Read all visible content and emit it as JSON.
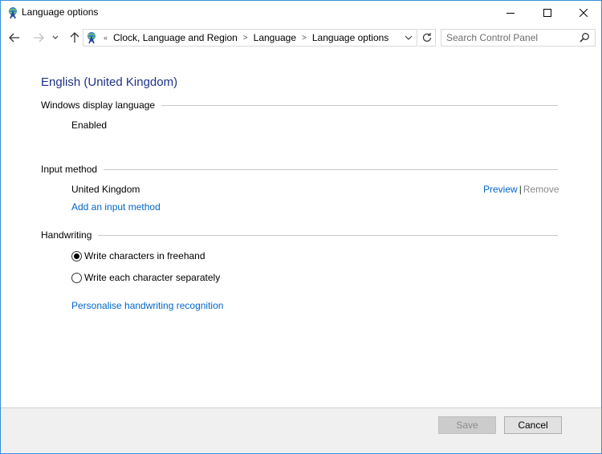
{
  "window": {
    "title": "Language options",
    "controls": {
      "minimize": "minimize",
      "maximize": "maximize",
      "close": "close"
    }
  },
  "navigation": {
    "back_icon": "arrow-left",
    "forward_icon": "arrow-right",
    "recent_icon": "chevron-down",
    "up_icon": "arrow-up",
    "overflow_indicator": "«",
    "breadcrumb": [
      "Clock, Language and Region",
      "Language",
      "Language options"
    ],
    "breadcrumb_separator": ">",
    "search": {
      "placeholder": "Search Control Panel",
      "value": ""
    }
  },
  "main": {
    "title": "English (United Kingdom)",
    "sections": {
      "display_language": {
        "heading": "Windows display language",
        "status": "Enabled"
      },
      "input_method": {
        "heading": "Input method",
        "methods": [
          {
            "name": "United Kingdom",
            "preview_label": "Preview",
            "remove_label": "Remove",
            "separator": "|"
          }
        ],
        "add_link": "Add an input method"
      },
      "handwriting": {
        "heading": "Handwriting",
        "options": [
          {
            "label": "Write characters in freehand",
            "selected": true
          },
          {
            "label": "Write each character separately",
            "selected": false
          }
        ],
        "personalise_link": "Personalise handwriting recognition"
      }
    }
  },
  "footer": {
    "save_label": "Save",
    "save_enabled": false,
    "cancel_label": "Cancel"
  },
  "colors": {
    "title_blue": "#1e3287",
    "link_blue": "#0066cc",
    "window_border": "#3a8fd6",
    "disabled_text": "#8a8a8a"
  }
}
